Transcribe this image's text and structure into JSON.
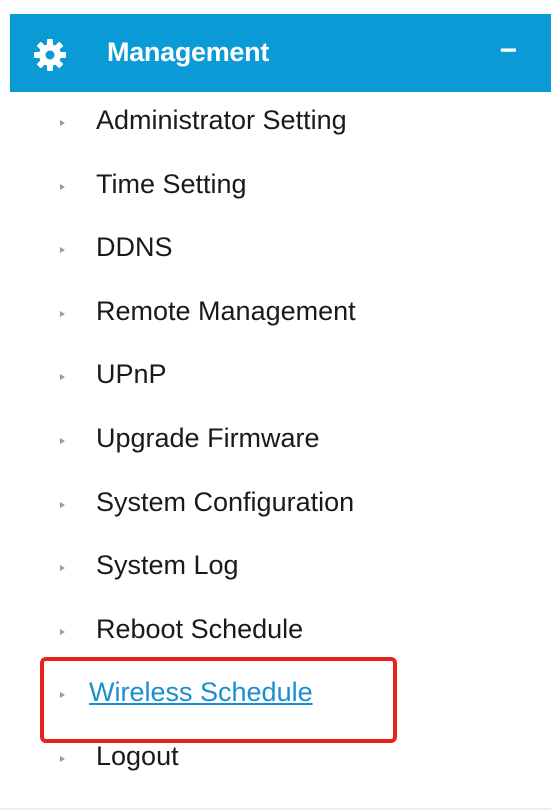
{
  "header": {
    "title": "Management",
    "collapse_symbol": "−",
    "icon": "gear-icon",
    "background_color": "#0a9ad6"
  },
  "menu": {
    "items": [
      {
        "label": "Administrator Setting"
      },
      {
        "label": "Time Setting"
      },
      {
        "label": "DDNS"
      },
      {
        "label": "Remote Management"
      },
      {
        "label": "UPnP"
      },
      {
        "label": "Upgrade Firmware"
      },
      {
        "label": "System Configuration"
      },
      {
        "label": "System Log"
      },
      {
        "label": "Reboot Schedule"
      },
      {
        "label": "Wireless Schedule",
        "active": true
      },
      {
        "label": "Logout"
      }
    ],
    "active_color": "#1a8fd0",
    "highlight_color": "#e8231f"
  }
}
